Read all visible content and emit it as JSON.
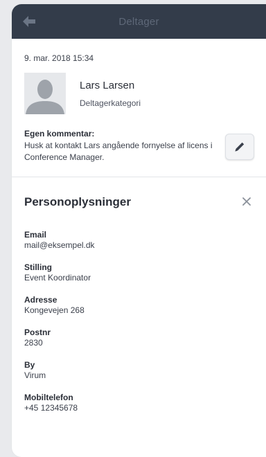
{
  "header": {
    "title": "Deltager",
    "back_icon": "arrow-left-icon"
  },
  "colors": {
    "header_bg": "#333c4a",
    "header_text": "#5e6878",
    "background": "#e9eaed"
  },
  "entry": {
    "timestamp": "9. mar. 2018 15:34",
    "name": "Lars Larsen",
    "category": "Deltagerkategori",
    "comment_label": "Egen kommentar:",
    "comment_text": "Husk at kontakt Lars angående fornyelse af licens i Conference Manager.",
    "edit_icon": "pencil-icon"
  },
  "personal_info": {
    "title": "Personoplysninger",
    "close_icon": "close-icon",
    "fields": [
      {
        "label": "Email",
        "value": "mail@eksempel.dk"
      },
      {
        "label": "Stilling",
        "value": "Event Koordinator"
      },
      {
        "label": "Adresse",
        "value": "Kongevejen 268"
      },
      {
        "label": "Postnr",
        "value": "2830"
      },
      {
        "label": "By",
        "value": "Virum"
      },
      {
        "label": "Mobiltelefon",
        "value": "+45 12345678"
      }
    ]
  }
}
